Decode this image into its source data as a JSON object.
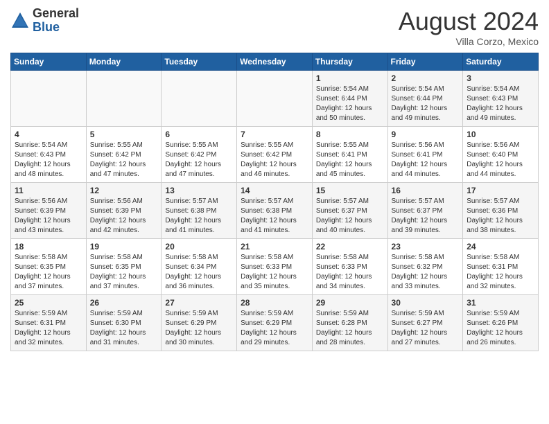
{
  "header": {
    "logo_general": "General",
    "logo_blue": "Blue",
    "title": "August 2024",
    "subtitle": "Villa Corzo, Mexico"
  },
  "weekdays": [
    "Sunday",
    "Monday",
    "Tuesday",
    "Wednesday",
    "Thursday",
    "Friday",
    "Saturday"
  ],
  "weeks": [
    [
      {
        "day": "",
        "info": ""
      },
      {
        "day": "",
        "info": ""
      },
      {
        "day": "",
        "info": ""
      },
      {
        "day": "",
        "info": ""
      },
      {
        "day": "1",
        "info": "Sunrise: 5:54 AM\nSunset: 6:44 PM\nDaylight: 12 hours\nand 50 minutes."
      },
      {
        "day": "2",
        "info": "Sunrise: 5:54 AM\nSunset: 6:44 PM\nDaylight: 12 hours\nand 49 minutes."
      },
      {
        "day": "3",
        "info": "Sunrise: 5:54 AM\nSunset: 6:43 PM\nDaylight: 12 hours\nand 49 minutes."
      }
    ],
    [
      {
        "day": "4",
        "info": "Sunrise: 5:54 AM\nSunset: 6:43 PM\nDaylight: 12 hours\nand 48 minutes."
      },
      {
        "day": "5",
        "info": "Sunrise: 5:55 AM\nSunset: 6:42 PM\nDaylight: 12 hours\nand 47 minutes."
      },
      {
        "day": "6",
        "info": "Sunrise: 5:55 AM\nSunset: 6:42 PM\nDaylight: 12 hours\nand 47 minutes."
      },
      {
        "day": "7",
        "info": "Sunrise: 5:55 AM\nSunset: 6:42 PM\nDaylight: 12 hours\nand 46 minutes."
      },
      {
        "day": "8",
        "info": "Sunrise: 5:55 AM\nSunset: 6:41 PM\nDaylight: 12 hours\nand 45 minutes."
      },
      {
        "day": "9",
        "info": "Sunrise: 5:56 AM\nSunset: 6:41 PM\nDaylight: 12 hours\nand 44 minutes."
      },
      {
        "day": "10",
        "info": "Sunrise: 5:56 AM\nSunset: 6:40 PM\nDaylight: 12 hours\nand 44 minutes."
      }
    ],
    [
      {
        "day": "11",
        "info": "Sunrise: 5:56 AM\nSunset: 6:39 PM\nDaylight: 12 hours\nand 43 minutes."
      },
      {
        "day": "12",
        "info": "Sunrise: 5:56 AM\nSunset: 6:39 PM\nDaylight: 12 hours\nand 42 minutes."
      },
      {
        "day": "13",
        "info": "Sunrise: 5:57 AM\nSunset: 6:38 PM\nDaylight: 12 hours\nand 41 minutes."
      },
      {
        "day": "14",
        "info": "Sunrise: 5:57 AM\nSunset: 6:38 PM\nDaylight: 12 hours\nand 41 minutes."
      },
      {
        "day": "15",
        "info": "Sunrise: 5:57 AM\nSunset: 6:37 PM\nDaylight: 12 hours\nand 40 minutes."
      },
      {
        "day": "16",
        "info": "Sunrise: 5:57 AM\nSunset: 6:37 PM\nDaylight: 12 hours\nand 39 minutes."
      },
      {
        "day": "17",
        "info": "Sunrise: 5:57 AM\nSunset: 6:36 PM\nDaylight: 12 hours\nand 38 minutes."
      }
    ],
    [
      {
        "day": "18",
        "info": "Sunrise: 5:58 AM\nSunset: 6:35 PM\nDaylight: 12 hours\nand 37 minutes."
      },
      {
        "day": "19",
        "info": "Sunrise: 5:58 AM\nSunset: 6:35 PM\nDaylight: 12 hours\nand 37 minutes."
      },
      {
        "day": "20",
        "info": "Sunrise: 5:58 AM\nSunset: 6:34 PM\nDaylight: 12 hours\nand 36 minutes."
      },
      {
        "day": "21",
        "info": "Sunrise: 5:58 AM\nSunset: 6:33 PM\nDaylight: 12 hours\nand 35 minutes."
      },
      {
        "day": "22",
        "info": "Sunrise: 5:58 AM\nSunset: 6:33 PM\nDaylight: 12 hours\nand 34 minutes."
      },
      {
        "day": "23",
        "info": "Sunrise: 5:58 AM\nSunset: 6:32 PM\nDaylight: 12 hours\nand 33 minutes."
      },
      {
        "day": "24",
        "info": "Sunrise: 5:58 AM\nSunset: 6:31 PM\nDaylight: 12 hours\nand 32 minutes."
      }
    ],
    [
      {
        "day": "25",
        "info": "Sunrise: 5:59 AM\nSunset: 6:31 PM\nDaylight: 12 hours\nand 32 minutes."
      },
      {
        "day": "26",
        "info": "Sunrise: 5:59 AM\nSunset: 6:30 PM\nDaylight: 12 hours\nand 31 minutes."
      },
      {
        "day": "27",
        "info": "Sunrise: 5:59 AM\nSunset: 6:29 PM\nDaylight: 12 hours\nand 30 minutes."
      },
      {
        "day": "28",
        "info": "Sunrise: 5:59 AM\nSunset: 6:29 PM\nDaylight: 12 hours\nand 29 minutes."
      },
      {
        "day": "29",
        "info": "Sunrise: 5:59 AM\nSunset: 6:28 PM\nDaylight: 12 hours\nand 28 minutes."
      },
      {
        "day": "30",
        "info": "Sunrise: 5:59 AM\nSunset: 6:27 PM\nDaylight: 12 hours\nand 27 minutes."
      },
      {
        "day": "31",
        "info": "Sunrise: 5:59 AM\nSunset: 6:26 PM\nDaylight: 12 hours\nand 26 minutes."
      }
    ]
  ]
}
